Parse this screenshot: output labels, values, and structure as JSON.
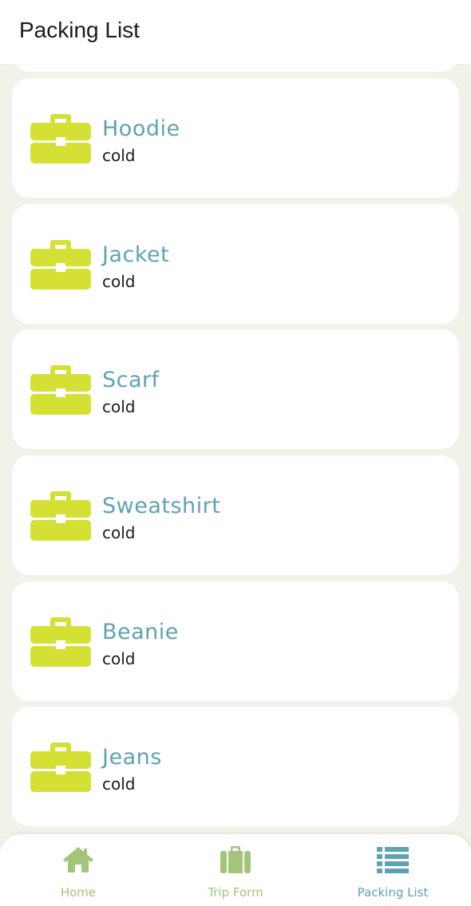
{
  "header": {
    "title": "Packing List"
  },
  "colors": {
    "item_name": "#5fa2b4",
    "briefcase": "#d4e034",
    "tab_inactive": "#a3c57a",
    "tab_active": "#5fa2b4",
    "background": "#f2f1ea"
  },
  "items": [
    {
      "name": "Hoodie",
      "tag": "cold",
      "icon": "briefcase-icon"
    },
    {
      "name": "Jacket",
      "tag": "cold",
      "icon": "briefcase-icon"
    },
    {
      "name": "Scarf",
      "tag": "cold",
      "icon": "briefcase-icon"
    },
    {
      "name": "Sweatshirt",
      "tag": "cold",
      "icon": "briefcase-icon"
    },
    {
      "name": "Beanie",
      "tag": "cold",
      "icon": "briefcase-icon"
    },
    {
      "name": "Jeans",
      "tag": "cold",
      "icon": "briefcase-icon"
    }
  ],
  "tabs": [
    {
      "label": "Home",
      "icon": "home-icon",
      "active": false
    },
    {
      "label": "Trip Form",
      "icon": "suitcase-icon",
      "active": false
    },
    {
      "label": "Packing List",
      "icon": "list-icon",
      "active": true
    }
  ]
}
